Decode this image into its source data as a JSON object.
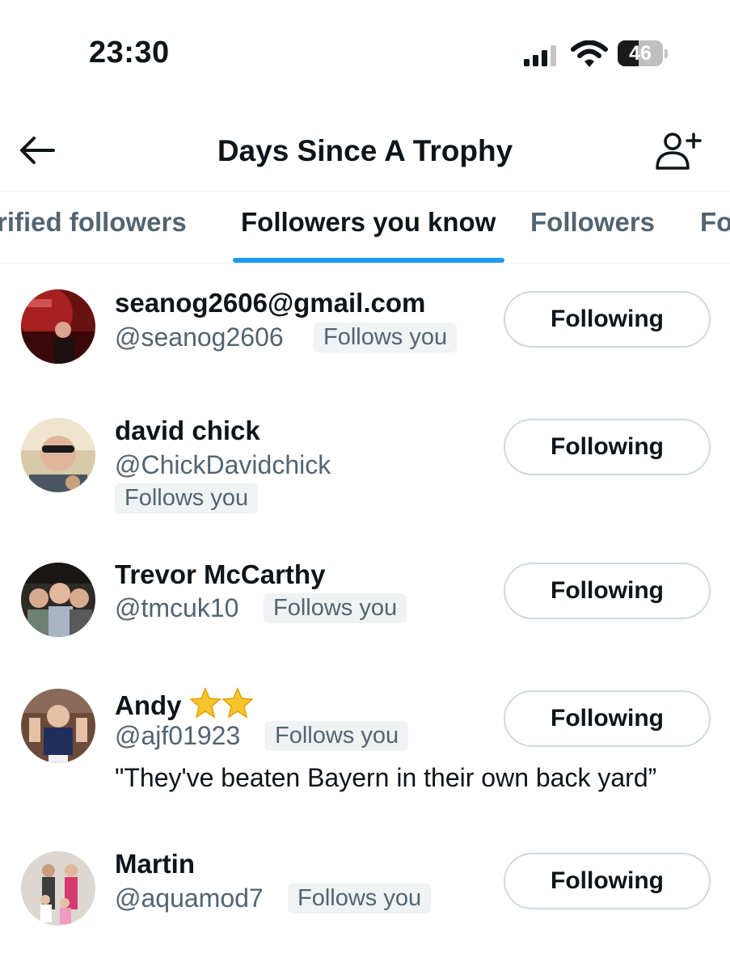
{
  "status_bar": {
    "time": "23:30",
    "battery_level": "46",
    "battery_fraction": 0.46
  },
  "header": {
    "title": "Days Since A Trophy",
    "back_icon": "arrow-left-icon",
    "action_icon": "add-user-icon"
  },
  "tabs": [
    {
      "label": "rified followers",
      "active": false
    },
    {
      "label": "Followers you know",
      "active": true
    },
    {
      "label": "Followers",
      "active": false
    },
    {
      "label": "Fo",
      "active": false
    }
  ],
  "colors": {
    "accent": "#1d9bf0",
    "secondary_text": "#536471",
    "primary_text": "#0f1419",
    "badge_bg": "#eff3f4",
    "button_border": "#cfd9de"
  },
  "users": [
    {
      "name": "seanog2606@gmail.com",
      "handle": "@seanog2606",
      "follows_you": "Follows you",
      "button": "Following"
    },
    {
      "name": "david chick",
      "handle": "@ChickDavidchick",
      "follows_you": "Follows you",
      "button": "Following"
    },
    {
      "name": "Trevor McCarthy",
      "handle": "@tmcuk10",
      "follows_you": "Follows you",
      "button": "Following"
    },
    {
      "name": "Andy",
      "name_emoji": "star-icon x2",
      "handle": "@ajf01923",
      "follows_you": "Follows you",
      "bio": "\"They've beaten Bayern in their own back yard”",
      "button": "Following"
    },
    {
      "name": "Martin",
      "handle": "@aquamod7",
      "follows_you": "Follows you",
      "button": "Following"
    }
  ]
}
